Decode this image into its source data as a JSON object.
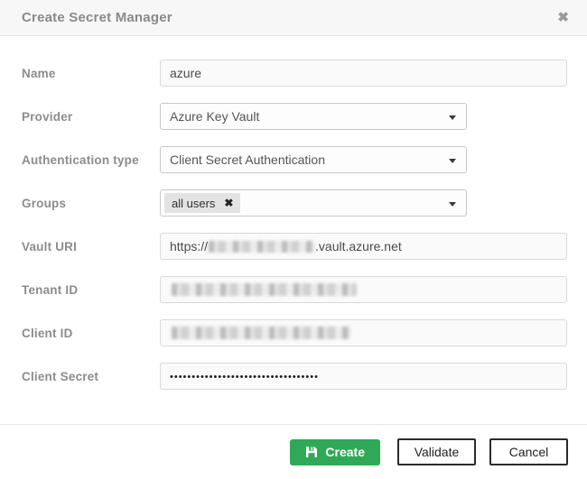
{
  "modal": {
    "title": "Create Secret Manager",
    "close_icon": "✖"
  },
  "fields": {
    "name": {
      "label": "Name",
      "value": "azure"
    },
    "provider": {
      "label": "Provider",
      "value": "Azure Key Vault"
    },
    "auth_type": {
      "label": "Authentication type",
      "value": "Client Secret Authentication"
    },
    "groups": {
      "label": "Groups",
      "selected": [
        {
          "label": "all users",
          "remove_icon": "✖"
        }
      ]
    },
    "vault_uri": {
      "label": "Vault URI",
      "prefix": "https://",
      "suffix": ".vault.azure.net",
      "redacted_segment": true
    },
    "tenant_id": {
      "label": "Tenant ID",
      "redacted": true
    },
    "client_id": {
      "label": "Client ID",
      "redacted": true
    },
    "client_secret": {
      "label": "Client Secret",
      "masked_value": "••••••••••••••••••••••••••••••••••"
    }
  },
  "footer": {
    "create_label": "Create",
    "validate_label": "Validate",
    "cancel_label": "Cancel"
  },
  "colors": {
    "create_green": "#2fa956",
    "header_bg": "#f7f7f7",
    "label_gray": "#8c8c8c"
  }
}
